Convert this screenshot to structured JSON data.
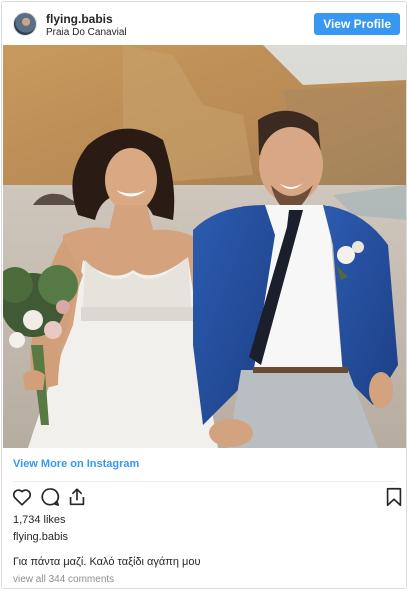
{
  "post": {
    "username": "flying.babis",
    "location": "Praia Do Canavial",
    "view_profile_label": "View Profile",
    "view_more_label": "View More on Instagram",
    "likes_count": "1,734",
    "likes_label": "likes",
    "caption_username": "flying.babis",
    "caption_text": "Για πάντα μαζί. Καλό ταξίδι αγάπη μου",
    "comments_link": "view all 344 comments"
  },
  "icons": {
    "like": "heart-icon",
    "comment": "comment-icon",
    "share": "share-icon",
    "save": "bookmark-icon"
  },
  "colors": {
    "accent": "#3897f0",
    "text": "#262626",
    "muted": "#8e8e8e",
    "border": "#dbdbdb"
  }
}
